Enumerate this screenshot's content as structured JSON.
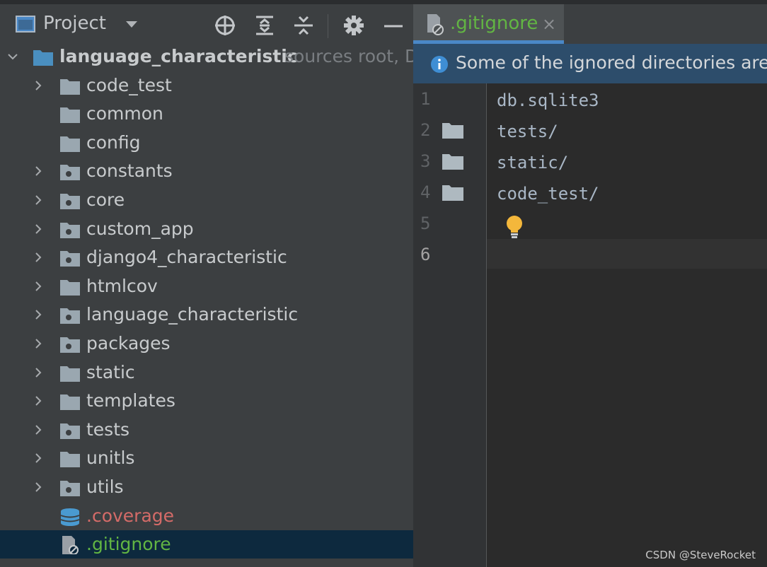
{
  "project_panel": {
    "title": "Project",
    "toolbar_icons": [
      "locate-icon",
      "expand-all-icon",
      "collapse-all-icon",
      "gear-icon",
      "hide-icon"
    ],
    "root": {
      "label": "language_characteristic",
      "hint": "sources root, D"
    },
    "items": [
      {
        "label": "code_test",
        "expandable": true,
        "icon": "folder"
      },
      {
        "label": "common",
        "expandable": false,
        "icon": "folder"
      },
      {
        "label": "config",
        "expandable": false,
        "icon": "folder"
      },
      {
        "label": "constants",
        "expandable": true,
        "icon": "package"
      },
      {
        "label": "core",
        "expandable": true,
        "icon": "package"
      },
      {
        "label": "custom_app",
        "expandable": true,
        "icon": "package"
      },
      {
        "label": "django4_characteristic",
        "expandable": true,
        "icon": "package"
      },
      {
        "label": "htmlcov",
        "expandable": true,
        "icon": "folder"
      },
      {
        "label": "language_characteristic",
        "expandable": true,
        "icon": "package"
      },
      {
        "label": "packages",
        "expandable": true,
        "icon": "package"
      },
      {
        "label": "static",
        "expandable": true,
        "icon": "folder"
      },
      {
        "label": "templates",
        "expandable": true,
        "icon": "folder"
      },
      {
        "label": "tests",
        "expandable": true,
        "icon": "package"
      },
      {
        "label": "unitls",
        "expandable": true,
        "icon": "folder"
      },
      {
        "label": "utils",
        "expandable": true,
        "icon": "package"
      }
    ],
    "files": [
      {
        "label": ".coverage",
        "icon": "database",
        "color": "#d46b68"
      },
      {
        "label": ".gitignore",
        "icon": "ignore-file",
        "color": "#62b543",
        "selected": true
      }
    ]
  },
  "editor": {
    "tab": {
      "label": ".gitignore",
      "close": "×"
    },
    "banner": "Some of the ignored directories are",
    "lines": [
      {
        "no": "1",
        "text": "db.sqlite3",
        "folder": false
      },
      {
        "no": "2",
        "text": "tests/",
        "folder": true
      },
      {
        "no": "3",
        "text": "static/",
        "folder": true
      },
      {
        "no": "4",
        "text": "code_test/",
        "folder": true
      },
      {
        "no": "5",
        "text": "",
        "folder": false
      },
      {
        "no": "6",
        "text": "",
        "folder": false
      }
    ],
    "current_line": 6
  },
  "watermark": "CSDN @SteveRocket",
  "colors": {
    "panel_bg": "#3c3f41",
    "editor_bg": "#2b2b2b",
    "selection": "#0d293e",
    "accent": "#4a88c7",
    "ignored_green": "#62b543",
    "coverage_red": "#d46b68"
  }
}
